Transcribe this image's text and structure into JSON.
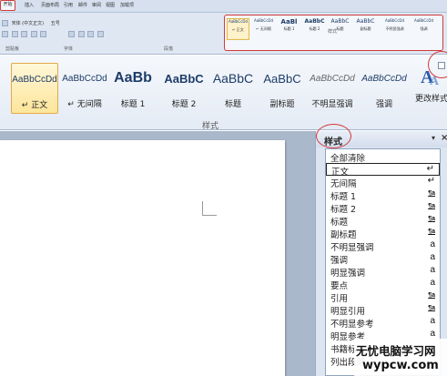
{
  "mini_ribbon": {
    "tabs": [
      "开始",
      "插入",
      "页面布局",
      "引用",
      "邮件",
      "审阅",
      "视图",
      "加载项"
    ],
    "font_name": "宋体 (中文正文)",
    "font_size": "五号",
    "groups": [
      "剪贴板",
      "字体",
      "段落",
      "样式"
    ],
    "styles": [
      {
        "sample": "AaBbCcDd",
        "label": "↵ 正文"
      },
      {
        "sample": "AaBbCcDd",
        "label": "↵ 无间隔"
      },
      {
        "sample": "AaBl",
        "label": "标题 1"
      },
      {
        "sample": "AaBbC",
        "label": "标题 2"
      },
      {
        "sample": "AaBbC",
        "label": "标题"
      },
      {
        "sample": "AaBbC",
        "label": "副标题"
      },
      {
        "sample": "AaBbCcDd",
        "label": "不明显强调"
      },
      {
        "sample": "AaBbCcDd",
        "label": "强调"
      }
    ]
  },
  "ribbon": {
    "styles": [
      {
        "sample": "AaBbCcDd",
        "label": "↵ 正文"
      },
      {
        "sample": "AaBbCcDd",
        "label": "↵ 无间隔"
      },
      {
        "sample": "AaBb",
        "label": "标题 1"
      },
      {
        "sample": "AaBbC",
        "label": "标题 2"
      },
      {
        "sample": "AaBbC",
        "label": "标题"
      },
      {
        "sample": "AaBbC",
        "label": "副标题"
      },
      {
        "sample": "AaBbCcDd",
        "label": "不明显强调"
      },
      {
        "sample": "AaBbCcDd",
        "label": "强调"
      }
    ],
    "group_label": "样式",
    "change_styles_label": "更改样式"
  },
  "styles_pane": {
    "title": "样式",
    "dropdown": "▾",
    "close": "×",
    "items": [
      {
        "name": "全部清除",
        "mark": ""
      },
      {
        "name": "正文",
        "mark": "↵"
      },
      {
        "name": "无间隔",
        "mark": "↵"
      },
      {
        "name": "标题 1",
        "mark": "¶a"
      },
      {
        "name": "标题 2",
        "mark": "¶a"
      },
      {
        "name": "标题",
        "mark": "¶a"
      },
      {
        "name": "副标题",
        "mark": "¶a"
      },
      {
        "name": "不明显强调",
        "mark": "a"
      },
      {
        "name": "强调",
        "mark": "a"
      },
      {
        "name": "明显强调",
        "mark": "a"
      },
      {
        "name": "要点",
        "mark": "a"
      },
      {
        "name": "引用",
        "mark": "¶a"
      },
      {
        "name": "明显引用",
        "mark": "¶a"
      },
      {
        "name": "不明显参考",
        "mark": "a"
      },
      {
        "name": "明显参考",
        "mark": "a"
      },
      {
        "name": "书籍标题",
        "mark": ""
      },
      {
        "name": "列出段落",
        "mark": ""
      }
    ]
  },
  "watermark": {
    "title": "无忧电脑学习网",
    "url": "wypcw.com"
  }
}
